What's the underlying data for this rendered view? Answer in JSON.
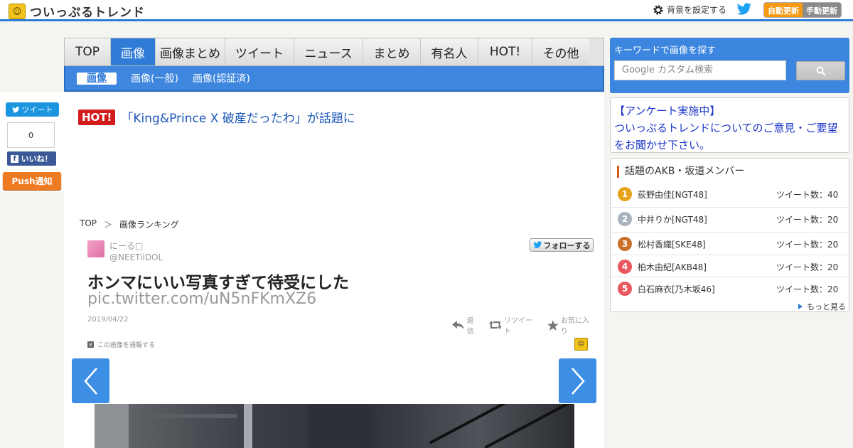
{
  "header": {
    "site_title": "ついっぷるトレンド",
    "bg_setting_label": "背景を設定する",
    "auto_update_label": "自動更新",
    "manual_update_label": "手動更新"
  },
  "social": {
    "tweet_label": "ツイート",
    "like_count": "0",
    "like_label": "いいね！",
    "push_label": "Push通知"
  },
  "nav": {
    "tabs": [
      "TOP",
      "画像",
      "画像まとめ",
      "ツイート",
      "ニュース",
      "まとめ",
      "有名人",
      "HOT!",
      "その他"
    ],
    "subtabs": [
      "画像",
      "画像(一般)",
      "画像(認証済)"
    ]
  },
  "hot": {
    "badge": "HOT!",
    "text": "「King&Prince X 破産だったわ」が話題に"
  },
  "breadcrumb": {
    "top": "TOP",
    "sep": "＞",
    "current": "画像ランキング"
  },
  "tweet": {
    "display_name": "にーる□",
    "handle": "@NEETiiDOL",
    "follow_label": "フォローする",
    "text": "ホンマにいい写真すぎて待受にした",
    "link": "pic.twitter.com/uN5nFKmXZ6",
    "date": "2019/04/22",
    "reply_label": "返信",
    "retweet_label": "リツイート",
    "favorite_label": "お気に入り",
    "report_label": "この画像を通報する"
  },
  "search": {
    "label": "キーワードで画像を探す",
    "placeholder": "Google カスタム検索"
  },
  "survey": {
    "line1": "【アンケート実施中】",
    "line2": "ついっぷるトレンドについてのご意見・ご要望をお聞かせ下さい。"
  },
  "ranking": {
    "title": "話題のAKB・坂道メンバー",
    "items": [
      {
        "rank": "1",
        "name": "荻野由佳[NGT48]",
        "count": "ツイート数：40",
        "color": "#e6a21a"
      },
      {
        "rank": "2",
        "name": "中井りか[NGT48]",
        "count": "ツイート数：20",
        "color": "#a9b2bd"
      },
      {
        "rank": "3",
        "name": "松村香織[SKE48]",
        "count": "ツイート数：20",
        "color": "#c8702a"
      },
      {
        "rank": "4",
        "name": "柏木由紀[AKB48]",
        "count": "ツイート数：20",
        "color": "#e8585e"
      },
      {
        "rank": "5",
        "name": "白石麻衣[乃木坂46]",
        "count": "ツイート数：20",
        "color": "#e8585e"
      }
    ],
    "more_label": "もっと見る"
  }
}
